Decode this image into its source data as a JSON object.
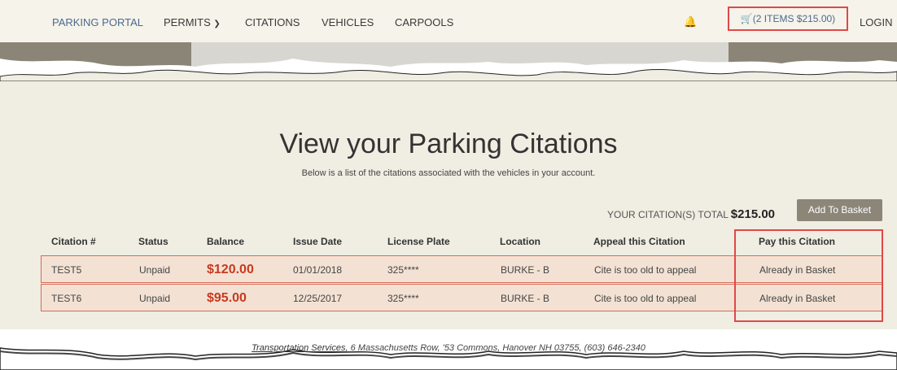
{
  "nav": {
    "brand": "PARKING PORTAL",
    "permits": "PERMITS",
    "citations": "CITATIONS",
    "vehicles": "VEHICLES",
    "carpools": "CARPOOLS",
    "basket": "(2 ITEMS $215.00)",
    "login": "LOGIN"
  },
  "page": {
    "title": "View your Parking Citations",
    "subtitle": "Below is a list of the citations associated with the vehicles in your account."
  },
  "summary": {
    "total_label": "YOUR CITATION(S) TOTAL",
    "total_amount": "$215.00",
    "add_button": "Add To Basket"
  },
  "table": {
    "headers": [
      "Citation #",
      "Status",
      "Balance",
      "Issue Date",
      "License Plate",
      "Location",
      "Appeal this Citation",
      "Pay this Citation"
    ],
    "rows": [
      [
        "TEST5",
        "Unpaid",
        "$120.00",
        "01/01/2018",
        "325****",
        "BURKE - B",
        "Cite is too old to appeal",
        "Already in Basket"
      ],
      [
        "TEST6",
        "Unpaid",
        "$95.00",
        "12/25/2017",
        "325****",
        "BURKE - B",
        "Cite is too old to appeal",
        "Already in Basket"
      ]
    ]
  },
  "footer": {
    "org": "Transportation Services",
    "address": ", 6 Massachusetts Row, '53 Commons, Hanover NH 03755, (603) 646-2340"
  },
  "colors": {
    "accent": "#4b6a8e",
    "highlight": "#e04848",
    "balance": "#c9391f",
    "row_bg": "#f3e2d4",
    "content_bg": "#f0ede2"
  },
  "icons": [
    "bell-icon",
    "cart-icon",
    "chevron-down-icon"
  ]
}
